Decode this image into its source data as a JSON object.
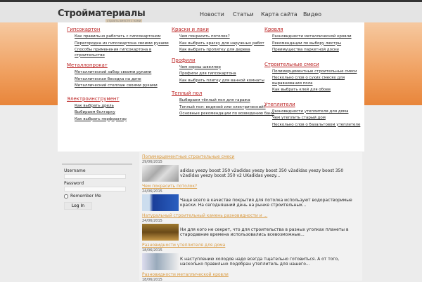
{
  "header": {
    "logo": "Стройматериалы",
    "slogan": "строить вместе с нами",
    "nav": [
      "Новости",
      "Статьи",
      "Карта сайта",
      "Видео"
    ]
  },
  "columns": [
    [
      {
        "title": "Гипсокартон",
        "links": [
          "Как правильно работать с гипсокартоном",
          "Перегородка из гипсокартона своими руками",
          "Способы применения гипсокартона в строительстве"
        ]
      },
      {
        "title": "Металлопрокат",
        "links": [
          "Металлический забор своими руками",
          "Металлическая беседка на даче",
          "Металлический стеллаж своими руками"
        ]
      },
      {
        "title": "Электроинструмент",
        "links": [
          "Как выбрать дрель",
          "Выбираем болгарку",
          "Как выбрать перфоратор"
        ]
      }
    ],
    [
      {
        "title": "Краски и лаки",
        "links": [
          "Чем покрасить потолок?",
          "Как выбрать краску для наружных работ",
          "Как выбрать пропитку для дерева"
        ]
      },
      {
        "title": "Профили",
        "links": [
          "Чем хорош швеллер",
          "Профили для гипсокартона",
          "Как выбрать плитку для ванной комнаты"
        ]
      },
      {
        "title": "Теплый пол",
        "links": [
          "Выбираем тёплый пол для гаража",
          "Теплый пол: водяной или электрический?",
          "Основные рекомендации по возведению бани"
        ]
      }
    ],
    [
      {
        "title": "Кровля",
        "links": [
          "Разновидности металлической кровли",
          "Рекомендации по выбору люстры",
          "Преимущества паркетной доски"
        ]
      },
      {
        "title": "Строительные смеси",
        "links": [
          "Полимерцементные строительные смеси",
          "Несколько слов о сухих смесях для выравнивания пола",
          "Как выбрать клей для обоев"
        ]
      },
      {
        "title": "Утеплители",
        "links": [
          "Разновидности утеплителя для дома",
          "Чем утеплить старый дом",
          "Несколько слов о базальтовом утеплителе"
        ]
      }
    ]
  ],
  "login": {
    "username": "Username",
    "password": "Password",
    "remember": "Remember Me",
    "button": "Log In"
  },
  "news": [
    {
      "title": "Полимерцементные строительные смеси",
      "date": "29/06/2015",
      "text": "adidas yeezy boost 350 v2adidas yeezy boost 350 v2adidas yeezy boost 350 v2adidas yeezy boost 350 v2 UKadidas yeezy..."
    },
    {
      "title": "Чем покрасить потолок?",
      "date": "24/06/2015",
      "text": "Чаще всего в качестве покрытия для потолка используют водорастворимые краски. На сегодняшний день на рынке строительных..."
    },
    {
      "title": "Натуральный строительный камень разновидности и ...",
      "date": "24/06/2015",
      "text": "Ни для кого не секрет, что для строительства в разных уголках планеты в стародавние времена использовались всевозможные..."
    },
    {
      "title": "Разновидности утеплителя для дома",
      "date": "18/06/2015",
      "text": "К наступлению холодов надо всегда тщательно готовиться. А от того, насколько правильно подобран утеплитель для нашего..."
    },
    {
      "title": "Разновидности металлической кровли",
      "date": "18/06/2015",
      "text": ""
    }
  ]
}
